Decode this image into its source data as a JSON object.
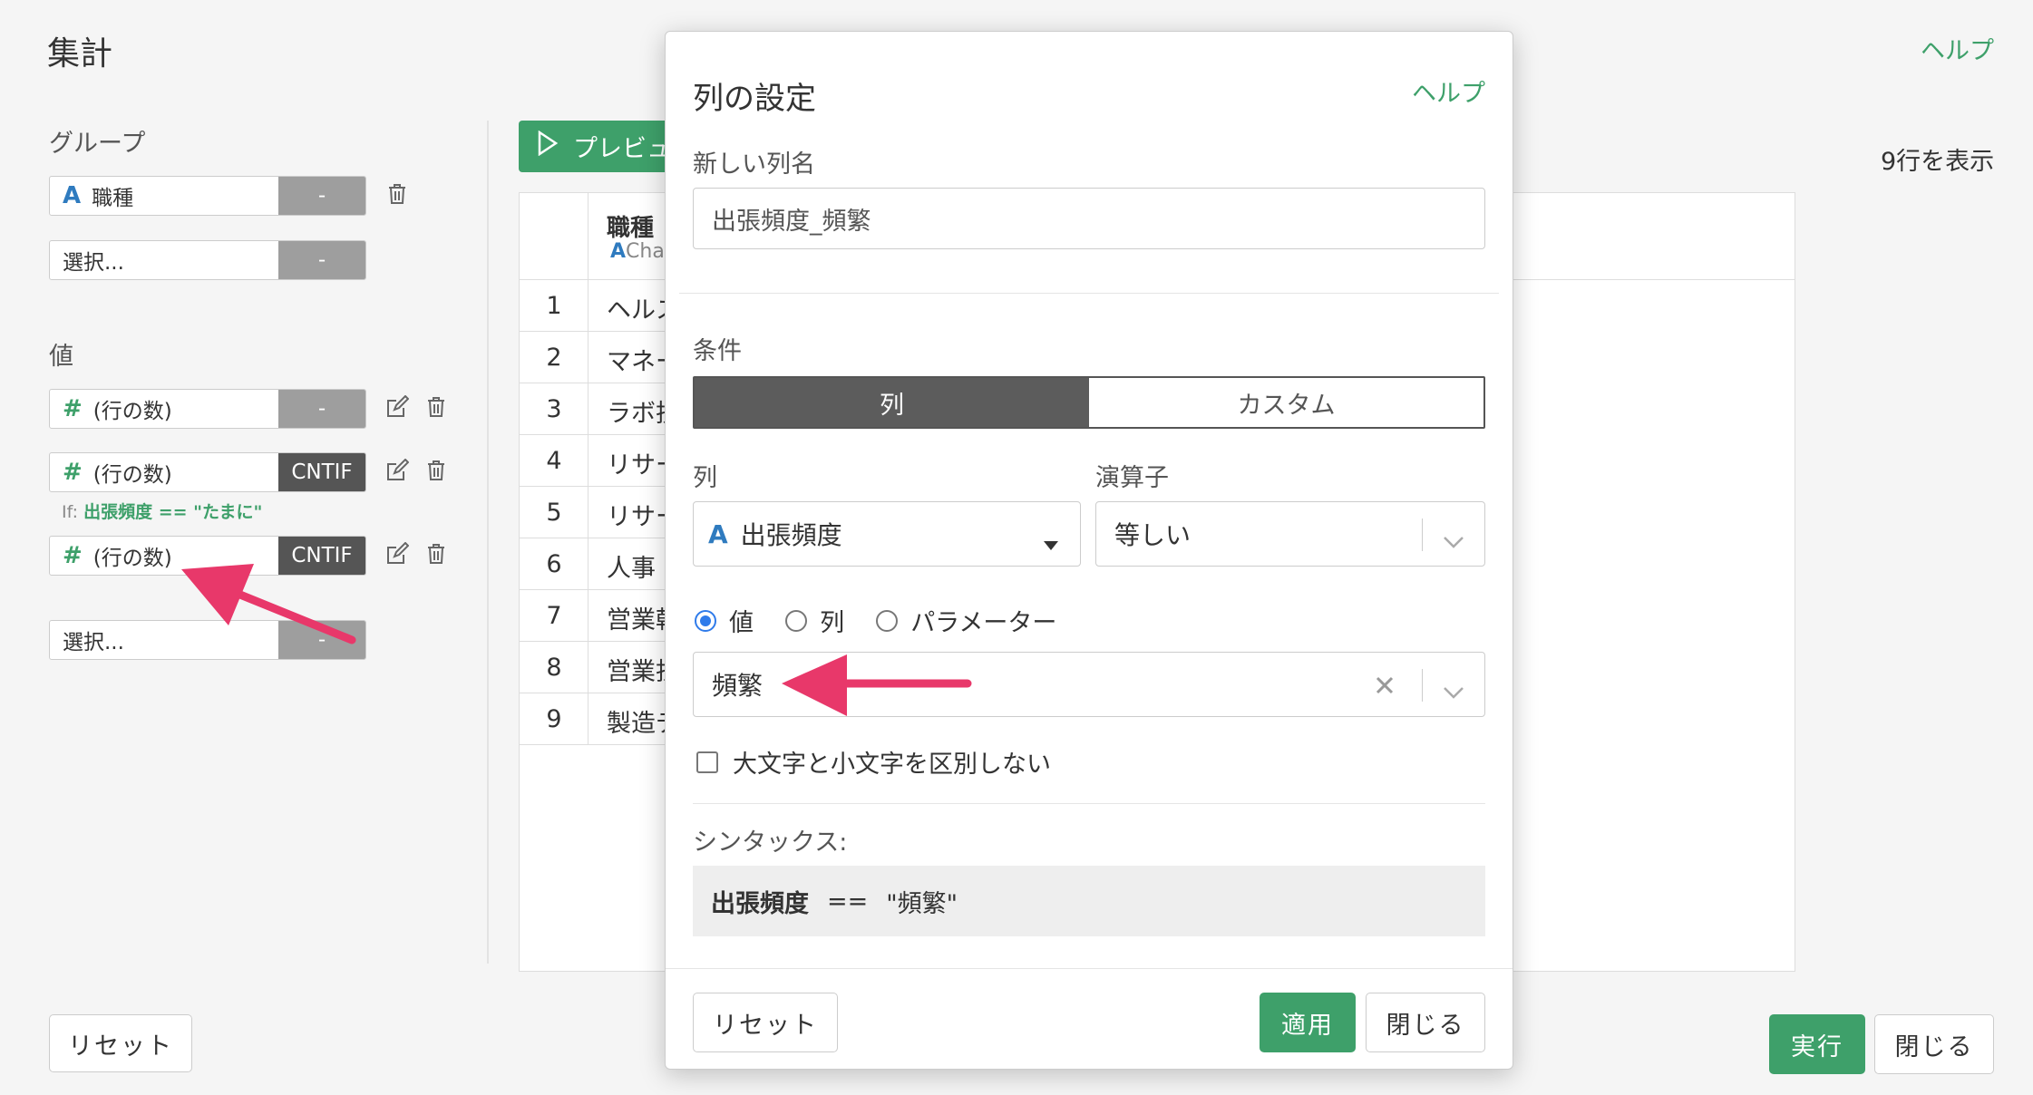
{
  "page": {
    "title": "集計",
    "help": "ヘルプ",
    "group_label": "グループ",
    "value_label": "値",
    "rows_info": "9行を表示",
    "preview_label": "プレビュ",
    "reset_label": "リセット",
    "run_label": "実行",
    "close_label": "閉じる"
  },
  "groups": [
    {
      "type": "A",
      "name": "職種",
      "agg": "-"
    },
    {
      "type": "",
      "name": "選択...",
      "agg": "-"
    }
  ],
  "values": [
    {
      "type": "#",
      "name": "(行の数)",
      "agg": "-"
    },
    {
      "type": "#",
      "name": "(行の数)",
      "agg": "CNTIF",
      "cond_prefix": "If:",
      "cond": "出張頻度 == \"たまに\""
    },
    {
      "type": "#",
      "name": "(行の数)",
      "agg": "CNTIF"
    },
    {
      "type": "",
      "name": "選択...",
      "agg": "-"
    }
  ],
  "table": {
    "header_name": "職種",
    "header_type": "Cha",
    "header_type_icon": "A",
    "rows": [
      {
        "n": "1",
        "v": "ヘルス"
      },
      {
        "n": "2",
        "v": "マネー"
      },
      {
        "n": "3",
        "v": "ラボ技"
      },
      {
        "n": "4",
        "v": "リサー"
      },
      {
        "n": "5",
        "v": "リサー"
      },
      {
        "n": "6",
        "v": "人事"
      },
      {
        "n": "7",
        "v": "営業幹"
      },
      {
        "n": "8",
        "v": "営業担"
      },
      {
        "n": "9",
        "v": "製造デ"
      }
    ]
  },
  "modal": {
    "title": "列の設定",
    "help": "ヘルプ",
    "new_col_label": "新しい列名",
    "new_col_value": "出張頻度_頻繁",
    "condition_label": "条件",
    "seg_column": "列",
    "seg_custom": "カスタム",
    "column_label": "列",
    "column_value": "出張頻度",
    "column_type_icon": "A",
    "operator_label": "演算子",
    "operator_value": "等しい",
    "radio_value": "値",
    "radio_column": "列",
    "radio_param": "パラメーター",
    "value_input": "頻繁",
    "case_label": "大文字と小文字を区別しない",
    "syntax_label": "シンタックス:",
    "syntax_col": "出張頻度",
    "syntax_op": "==",
    "syntax_val": "\"頻繁\"",
    "reset": "リセット",
    "apply": "適用",
    "close": "閉じる"
  },
  "colors": {
    "accent_green": "#3ea06a",
    "type_blue": "#2f7bbf",
    "arrow_pink": "#e8386a"
  }
}
